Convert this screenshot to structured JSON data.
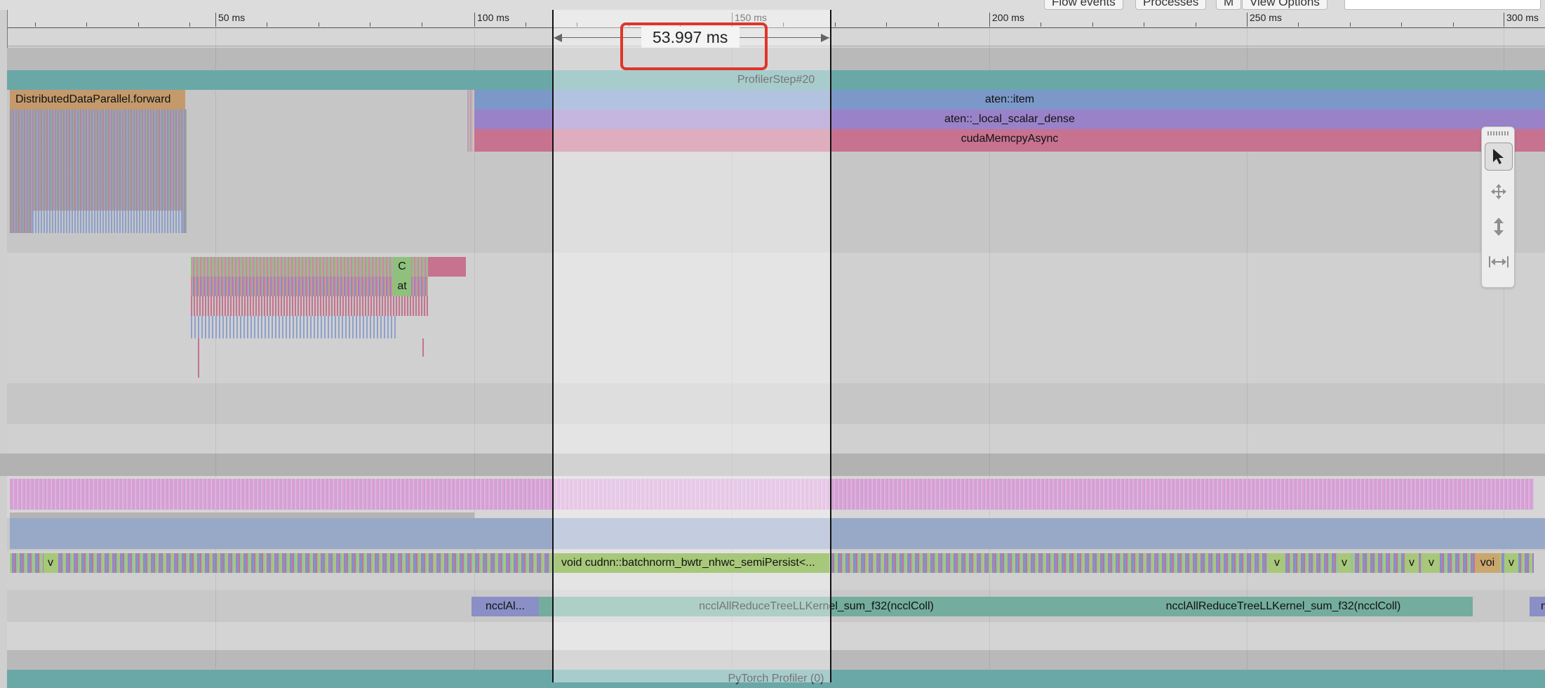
{
  "toolbar": {
    "buttons": [
      "Flow events",
      "Processes",
      "M",
      "View Options"
    ],
    "search_value": ""
  },
  "ruler": {
    "ticks": [
      "50 ms",
      "100 ms",
      "150 ms",
      "200 ms",
      "250 ms",
      "300 ms"
    ]
  },
  "selection": {
    "duration": "53.997 ms",
    "highlight_color": "#e0352b"
  },
  "tracks": {
    "profiler_step": "ProfilerStep#20",
    "ddp_forward": "DistributedDataParallel.forward",
    "aten_item": "aten::item",
    "local_scalar_dense": "aten::_local_scalar_dense",
    "cuda_memcpy": "cudaMemcpyAsync",
    "small_c": "C",
    "small_at": "at",
    "kernel_main": "void cudnn::batchnorm_bwtr_nhwc_semiPersist<...",
    "kernel_v": "v",
    "kernel_voi": "voi",
    "nccl_short": "ncclAl...",
    "nccl_full": "ncclAllReduceTreeLLKernel_sum_f32(ncclColl)",
    "nccl_edge": "n",
    "footer": "PyTorch Profiler (0)"
  },
  "tools": [
    "select-tool",
    "pan-tool",
    "zoom-tool",
    "timing-tool"
  ],
  "colors": {
    "profiler_step": "#6aa8a8",
    "ddp_forward": "#c49a6c",
    "aten_item": "#7b98c9",
    "local_scalar_dense": "#9a82c9",
    "cuda_memcpy": "#c7728f",
    "kernel_green": "#a7c87a",
    "nccl": "#74ad9d"
  }
}
